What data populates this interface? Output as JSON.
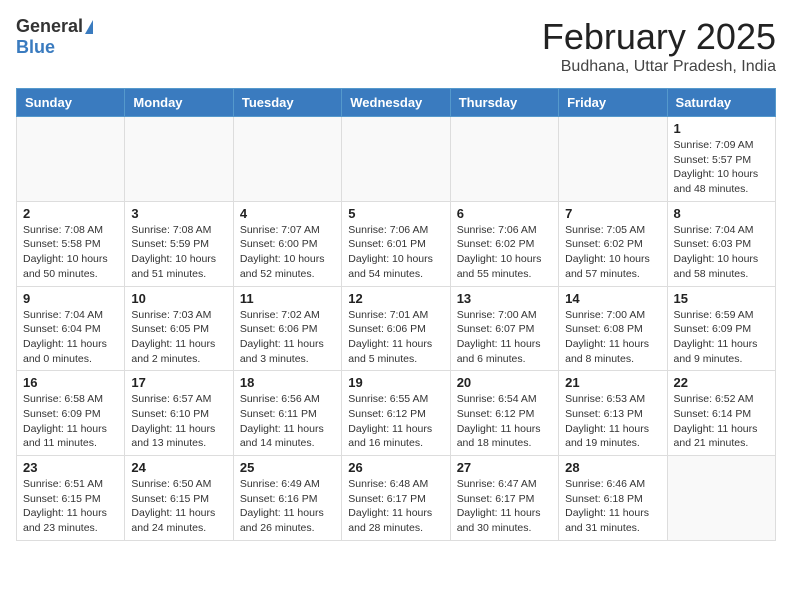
{
  "header": {
    "logo_general": "General",
    "logo_blue": "Blue",
    "month_title": "February 2025",
    "location": "Budhana, Uttar Pradesh, India"
  },
  "weekdays": [
    "Sunday",
    "Monday",
    "Tuesday",
    "Wednesday",
    "Thursday",
    "Friday",
    "Saturday"
  ],
  "weeks": [
    [
      {
        "day": "",
        "info": ""
      },
      {
        "day": "",
        "info": ""
      },
      {
        "day": "",
        "info": ""
      },
      {
        "day": "",
        "info": ""
      },
      {
        "day": "",
        "info": ""
      },
      {
        "day": "",
        "info": ""
      },
      {
        "day": "1",
        "info": "Sunrise: 7:09 AM\nSunset: 5:57 PM\nDaylight: 10 hours and 48 minutes."
      }
    ],
    [
      {
        "day": "2",
        "info": "Sunrise: 7:08 AM\nSunset: 5:58 PM\nDaylight: 10 hours and 50 minutes."
      },
      {
        "day": "3",
        "info": "Sunrise: 7:08 AM\nSunset: 5:59 PM\nDaylight: 10 hours and 51 minutes."
      },
      {
        "day": "4",
        "info": "Sunrise: 7:07 AM\nSunset: 6:00 PM\nDaylight: 10 hours and 52 minutes."
      },
      {
        "day": "5",
        "info": "Sunrise: 7:06 AM\nSunset: 6:01 PM\nDaylight: 10 hours and 54 minutes."
      },
      {
        "day": "6",
        "info": "Sunrise: 7:06 AM\nSunset: 6:02 PM\nDaylight: 10 hours and 55 minutes."
      },
      {
        "day": "7",
        "info": "Sunrise: 7:05 AM\nSunset: 6:02 PM\nDaylight: 10 hours and 57 minutes."
      },
      {
        "day": "8",
        "info": "Sunrise: 7:04 AM\nSunset: 6:03 PM\nDaylight: 10 hours and 58 minutes."
      }
    ],
    [
      {
        "day": "9",
        "info": "Sunrise: 7:04 AM\nSunset: 6:04 PM\nDaylight: 11 hours and 0 minutes."
      },
      {
        "day": "10",
        "info": "Sunrise: 7:03 AM\nSunset: 6:05 PM\nDaylight: 11 hours and 2 minutes."
      },
      {
        "day": "11",
        "info": "Sunrise: 7:02 AM\nSunset: 6:06 PM\nDaylight: 11 hours and 3 minutes."
      },
      {
        "day": "12",
        "info": "Sunrise: 7:01 AM\nSunset: 6:06 PM\nDaylight: 11 hours and 5 minutes."
      },
      {
        "day": "13",
        "info": "Sunrise: 7:00 AM\nSunset: 6:07 PM\nDaylight: 11 hours and 6 minutes."
      },
      {
        "day": "14",
        "info": "Sunrise: 7:00 AM\nSunset: 6:08 PM\nDaylight: 11 hours and 8 minutes."
      },
      {
        "day": "15",
        "info": "Sunrise: 6:59 AM\nSunset: 6:09 PM\nDaylight: 11 hours and 9 minutes."
      }
    ],
    [
      {
        "day": "16",
        "info": "Sunrise: 6:58 AM\nSunset: 6:09 PM\nDaylight: 11 hours and 11 minutes."
      },
      {
        "day": "17",
        "info": "Sunrise: 6:57 AM\nSunset: 6:10 PM\nDaylight: 11 hours and 13 minutes."
      },
      {
        "day": "18",
        "info": "Sunrise: 6:56 AM\nSunset: 6:11 PM\nDaylight: 11 hours and 14 minutes."
      },
      {
        "day": "19",
        "info": "Sunrise: 6:55 AM\nSunset: 6:12 PM\nDaylight: 11 hours and 16 minutes."
      },
      {
        "day": "20",
        "info": "Sunrise: 6:54 AM\nSunset: 6:12 PM\nDaylight: 11 hours and 18 minutes."
      },
      {
        "day": "21",
        "info": "Sunrise: 6:53 AM\nSunset: 6:13 PM\nDaylight: 11 hours and 19 minutes."
      },
      {
        "day": "22",
        "info": "Sunrise: 6:52 AM\nSunset: 6:14 PM\nDaylight: 11 hours and 21 minutes."
      }
    ],
    [
      {
        "day": "23",
        "info": "Sunrise: 6:51 AM\nSunset: 6:15 PM\nDaylight: 11 hours and 23 minutes."
      },
      {
        "day": "24",
        "info": "Sunrise: 6:50 AM\nSunset: 6:15 PM\nDaylight: 11 hours and 24 minutes."
      },
      {
        "day": "25",
        "info": "Sunrise: 6:49 AM\nSunset: 6:16 PM\nDaylight: 11 hours and 26 minutes."
      },
      {
        "day": "26",
        "info": "Sunrise: 6:48 AM\nSunset: 6:17 PM\nDaylight: 11 hours and 28 minutes."
      },
      {
        "day": "27",
        "info": "Sunrise: 6:47 AM\nSunset: 6:17 PM\nDaylight: 11 hours and 30 minutes."
      },
      {
        "day": "28",
        "info": "Sunrise: 6:46 AM\nSunset: 6:18 PM\nDaylight: 11 hours and 31 minutes."
      },
      {
        "day": "",
        "info": ""
      }
    ]
  ]
}
